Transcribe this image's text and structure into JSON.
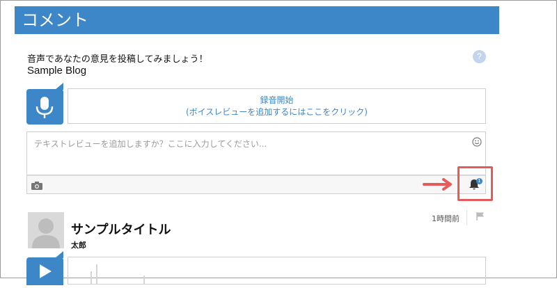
{
  "header": {
    "title": "コメント"
  },
  "prompt": {
    "text": "音声であなたの意見を投稿してみましょう！",
    "blog_name": "Sample Blog"
  },
  "help": {
    "symbol": "?"
  },
  "record": {
    "line1": "録音開始",
    "line2": "(ボイスレビューを追加するにはここをクリック)"
  },
  "text_review": {
    "placeholder": "テキストレビューを追加しますか？ここに入力してください..."
  },
  "notification": {
    "badge": "1"
  },
  "post": {
    "title": "サンプルタイトル",
    "author": "太郎",
    "time": "1時間前"
  },
  "icons": {
    "mic": "microphone-icon",
    "camera": "camera-icon",
    "smiley": "smiley-icon",
    "bell": "bell-icon",
    "flag": "flag-icon",
    "play": "play-icon",
    "help": "help-icon",
    "arrow": "right-arrow-icon",
    "avatar": "avatar-placeholder"
  },
  "colors": {
    "accent": "#3d86c8",
    "highlight": "#e75a5a",
    "muted": "#9a9a9a"
  }
}
